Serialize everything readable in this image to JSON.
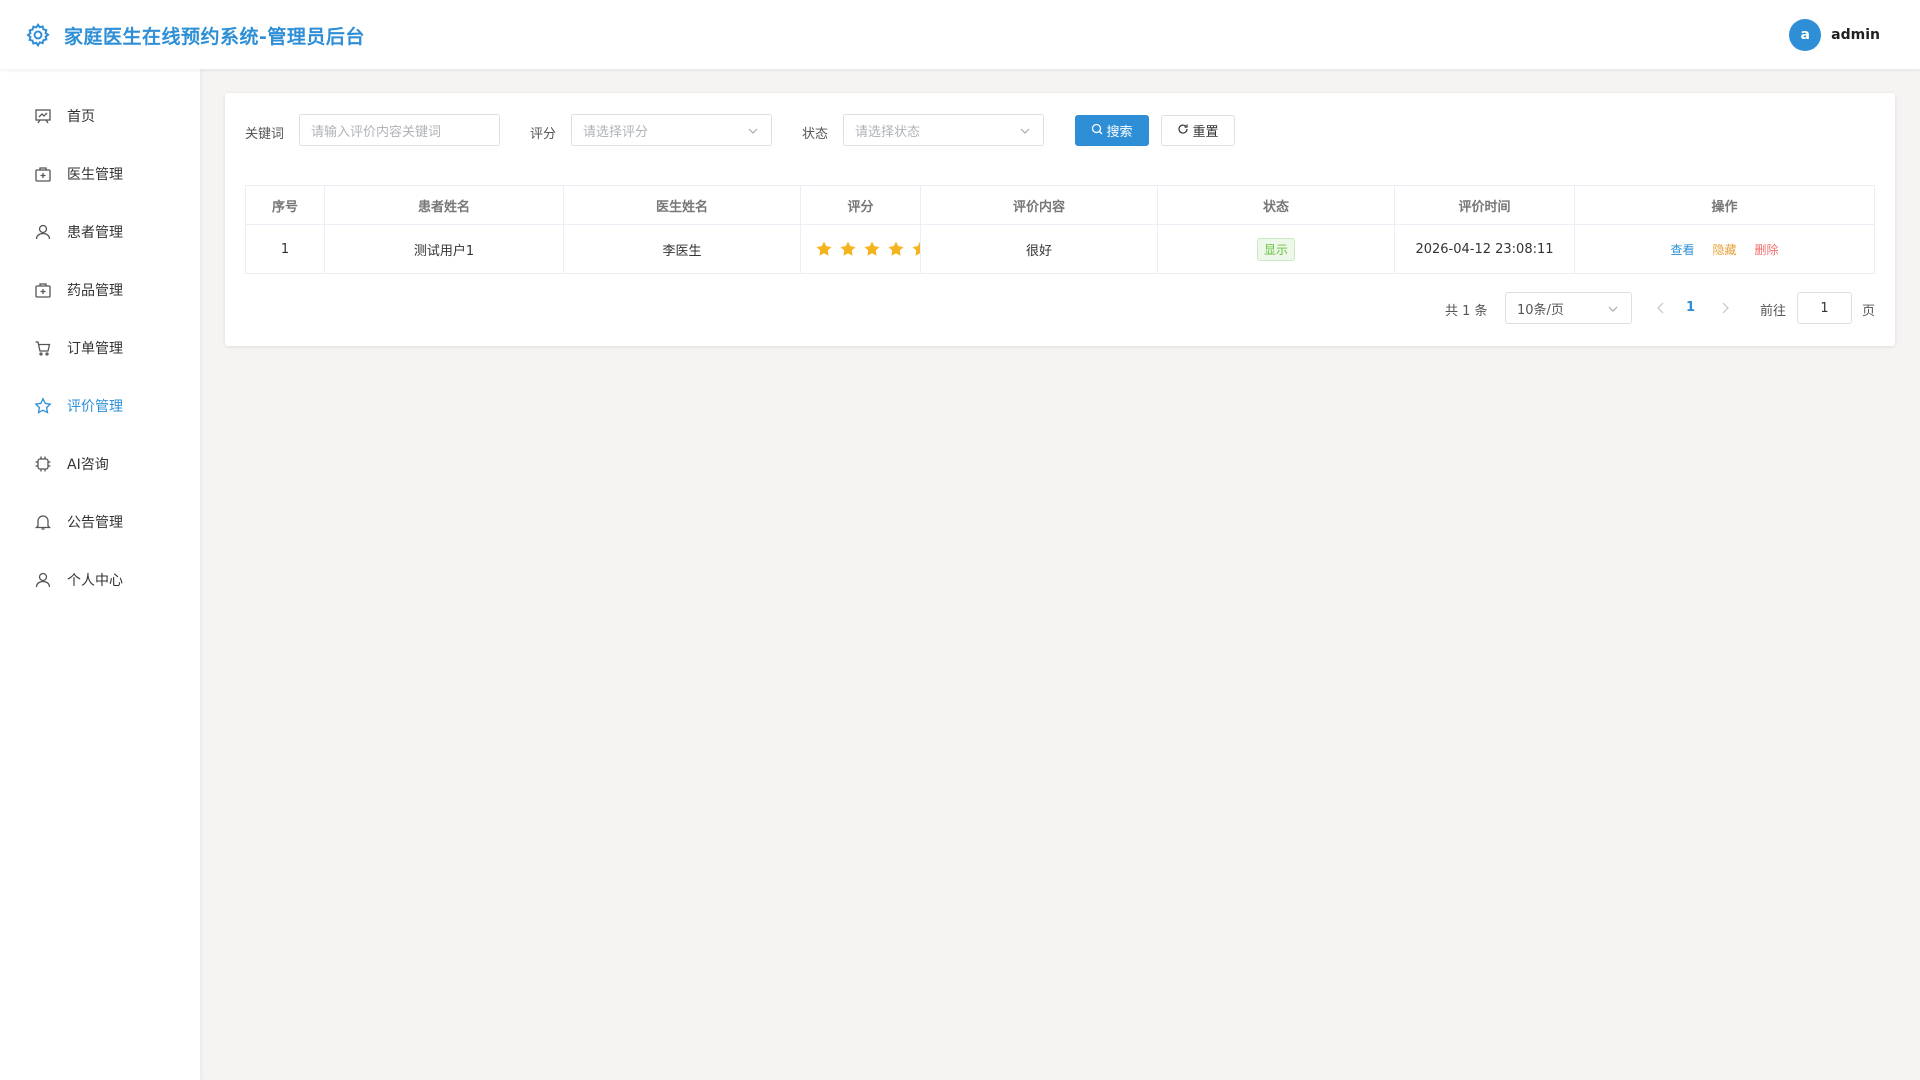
{
  "header": {
    "title": "家庭医生在线预约系统-管理员后台",
    "logo_icon": "gear-icon",
    "avatar_letter": "a",
    "username": "admin"
  },
  "sidebar": {
    "items": [
      {
        "label": "首页",
        "icon": "chart-board-icon"
      },
      {
        "label": "医生管理",
        "icon": "medical-kit-icon"
      },
      {
        "label": "患者管理",
        "icon": "user-icon"
      },
      {
        "label": "药品管理",
        "icon": "medicine-box-icon"
      },
      {
        "label": "订单管理",
        "icon": "cart-icon"
      },
      {
        "label": "评价管理",
        "icon": "star-icon",
        "active": true
      },
      {
        "label": "AI咨询",
        "icon": "cpu-icon"
      },
      {
        "label": "公告管理",
        "icon": "bell-icon"
      },
      {
        "label": "个人中心",
        "icon": "user-icon"
      }
    ]
  },
  "filters": {
    "keyword_label": "关键词",
    "keyword_placeholder": "请输入评价内容关键词",
    "rating_label": "评分",
    "rating_placeholder": "请选择评分",
    "status_label": "状态",
    "status_placeholder": "请选择状态",
    "search_label": "搜索",
    "reset_label": "重置"
  },
  "table": {
    "columns": [
      "序号",
      "患者姓名",
      "医生姓名",
      "评分",
      "评价内容",
      "状态",
      "评价时间",
      "操作"
    ],
    "rows": [
      {
        "index": "1",
        "patient": "测试用户1",
        "doctor": "李医生",
        "rating": 5,
        "content": "很好",
        "status": "显示",
        "time": "2026-04-12 23:08:11",
        "actions": [
          "查看",
          "隐藏",
          "删除"
        ]
      }
    ]
  },
  "pagination": {
    "total_text": "共 1 条",
    "page_size": "10条/页",
    "current_page": "1",
    "goto_label": "前往",
    "goto_value": "1",
    "unit": "页"
  },
  "colors": {
    "accent": "#2e8fd6",
    "star": "#f5b41e",
    "success": "#67c23a",
    "warning": "#e6a23c",
    "danger": "#f56c6c"
  }
}
